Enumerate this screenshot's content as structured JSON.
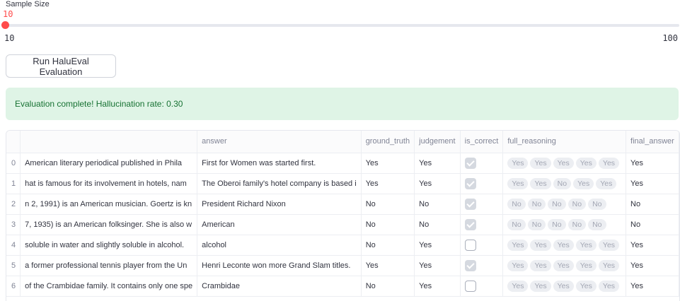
{
  "slider": {
    "label": "Sample Size",
    "value": "10",
    "min": "10",
    "max": "100",
    "fraction": 0
  },
  "run_button": {
    "label": "Run HaluEval Evaluation"
  },
  "alert": {
    "message": "Evaluation complete! Hallucination rate: 0.30"
  },
  "table": {
    "columns": [
      "",
      "",
      "answer",
      "ground_truth",
      "judgement",
      "is_correct",
      "full_reasoning",
      "final_answer"
    ],
    "rows": [
      {
        "index": "0",
        "knowledge": "American literary periodical published in Phila",
        "answer": "First for Women was started first.",
        "ground_truth": "Yes",
        "judgement": "Yes",
        "is_correct": true,
        "reasoning": [
          "Yes",
          "Yes",
          "Yes",
          "Yes",
          "Yes"
        ],
        "final_answer": "Yes"
      },
      {
        "index": "1",
        "knowledge": "hat is famous for its involvement in hotels, nam",
        "answer": "The Oberoi family's hotel company is based i",
        "ground_truth": "Yes",
        "judgement": "Yes",
        "is_correct": true,
        "reasoning": [
          "Yes",
          "Yes",
          "No",
          "Yes",
          "Yes"
        ],
        "final_answer": "Yes"
      },
      {
        "index": "2",
        "knowledge": "n 2, 1991) is an American musician. Goertz is kn",
        "answer": "President Richard Nixon",
        "ground_truth": "No",
        "judgement": "No",
        "is_correct": true,
        "reasoning": [
          "No",
          "No",
          "No",
          "No",
          "No"
        ],
        "final_answer": "No"
      },
      {
        "index": "3",
        "knowledge": "7, 1935) is an American folksinger. She is also w",
        "answer": "American",
        "ground_truth": "No",
        "judgement": "No",
        "is_correct": true,
        "reasoning": [
          "No",
          "No",
          "No",
          "No",
          "No"
        ],
        "final_answer": "No"
      },
      {
        "index": "4",
        "knowledge": "soluble in water and slightly soluble in alcohol.",
        "answer": "alcohol",
        "ground_truth": "No",
        "judgement": "Yes",
        "is_correct": false,
        "reasoning": [
          "Yes",
          "Yes",
          "Yes",
          "Yes",
          "Yes"
        ],
        "final_answer": "Yes"
      },
      {
        "index": "5",
        "knowledge": "a former professional tennis player from the Un",
        "answer": "Henri Leconte won more Grand Slam titles.",
        "ground_truth": "Yes",
        "judgement": "Yes",
        "is_correct": true,
        "reasoning": [
          "Yes",
          "Yes",
          "Yes",
          "Yes",
          "Yes"
        ],
        "final_answer": "Yes"
      },
      {
        "index": "6",
        "knowledge": "of the Crambidae family. It contains only one spe",
        "answer": "Crambidae",
        "ground_truth": "No",
        "judgement": "Yes",
        "is_correct": false,
        "reasoning": [
          "Yes",
          "Yes",
          "Yes",
          "Yes",
          "Yes"
        ],
        "final_answer": "Yes"
      }
    ]
  }
}
